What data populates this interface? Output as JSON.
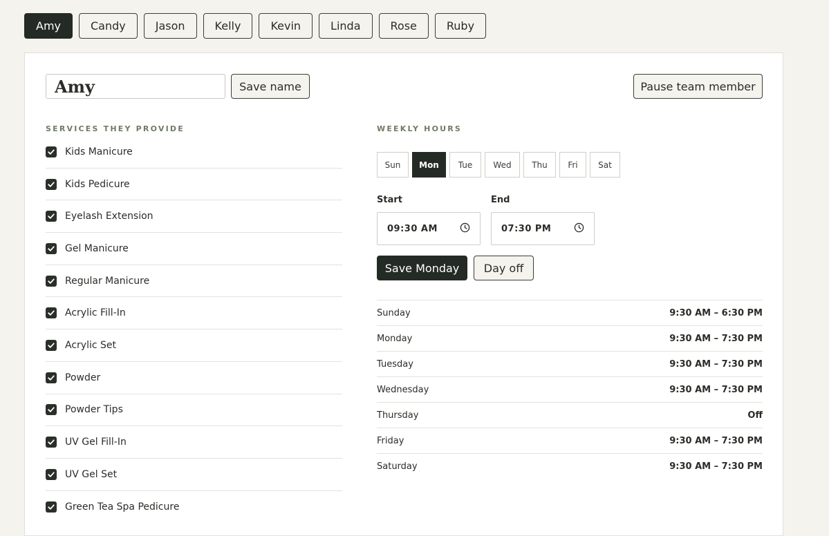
{
  "team_tabs": [
    {
      "label": "Amy",
      "active": true
    },
    {
      "label": "Candy",
      "active": false
    },
    {
      "label": "Jason",
      "active": false
    },
    {
      "label": "Kelly",
      "active": false
    },
    {
      "label": "Kevin",
      "active": false
    },
    {
      "label": "Linda",
      "active": false
    },
    {
      "label": "Rose",
      "active": false
    },
    {
      "label": "Ruby",
      "active": false
    }
  ],
  "member": {
    "name_value": "Amy",
    "save_name_label": "Save name",
    "pause_label": "Pause team member"
  },
  "services": {
    "title": "SERVICES THEY PROVIDE",
    "items": [
      {
        "label": "Kids Manicure",
        "checked": true
      },
      {
        "label": "Kids Pedicure",
        "checked": true
      },
      {
        "label": "Eyelash Extension",
        "checked": true
      },
      {
        "label": "Gel Manicure",
        "checked": true
      },
      {
        "label": "Regular Manicure",
        "checked": true
      },
      {
        "label": "Acrylic Fill-In",
        "checked": true
      },
      {
        "label": "Acrylic Set",
        "checked": true
      },
      {
        "label": "Powder",
        "checked": true
      },
      {
        "label": "Powder Tips",
        "checked": true
      },
      {
        "label": "UV Gel Fill-In",
        "checked": true
      },
      {
        "label": "UV Gel Set",
        "checked": true
      },
      {
        "label": "Green Tea Spa Pedicure",
        "checked": true
      }
    ]
  },
  "weekly_hours": {
    "title": "WEEKLY HOURS",
    "days": [
      {
        "label": "Sun",
        "active": false
      },
      {
        "label": "Mon",
        "active": true
      },
      {
        "label": "Tue",
        "active": false
      },
      {
        "label": "Wed",
        "active": false
      },
      {
        "label": "Thu",
        "active": false
      },
      {
        "label": "Fri",
        "active": false
      },
      {
        "label": "Sat",
        "active": false
      }
    ],
    "start_label": "Start",
    "start_value": "09:30 AM",
    "end_label": "End",
    "end_value": "07:30 PM",
    "save_day_label": "Save Monday",
    "day_off_label": "Day off",
    "summary": [
      {
        "day": "Sunday",
        "hours": "9:30 AM – 6:30 PM"
      },
      {
        "day": "Monday",
        "hours": "9:30 AM – 7:30 PM"
      },
      {
        "day": "Tuesday",
        "hours": "9:30 AM – 7:30 PM"
      },
      {
        "day": "Wednesday",
        "hours": "9:30 AM – 7:30 PM"
      },
      {
        "day": "Thursday",
        "hours": "Off"
      },
      {
        "day": "Friday",
        "hours": "9:30 AM – 7:30 PM"
      },
      {
        "day": "Saturday",
        "hours": "9:30 AM – 7:30 PM"
      }
    ]
  },
  "colors": {
    "accent_dark": "#242a24",
    "section_title": "#6f7c63",
    "background": "#f5f3ee"
  }
}
